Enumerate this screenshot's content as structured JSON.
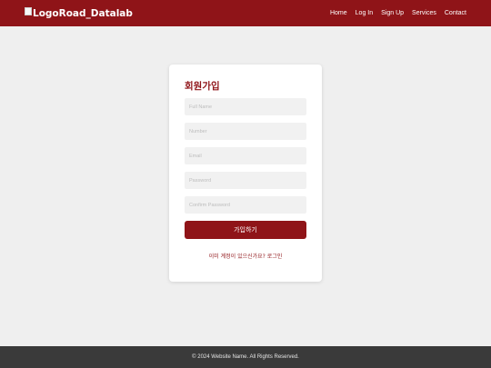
{
  "header": {
    "logo_text": "LogoRoad_Datalab",
    "nav": [
      {
        "label": "Home"
      },
      {
        "label": "Log In"
      },
      {
        "label": "Sign Up"
      },
      {
        "label": "Services"
      },
      {
        "label": "Contact"
      }
    ]
  },
  "signup": {
    "title": "회원가입",
    "fields": {
      "full_name": {
        "placeholder": "Full Name",
        "value": ""
      },
      "number": {
        "placeholder": "Number",
        "value": ""
      },
      "email": {
        "placeholder": "Email",
        "value": ""
      },
      "password": {
        "placeholder": "Password",
        "value": ""
      },
      "confirm_password": {
        "placeholder": "Confirm Password",
        "value": ""
      }
    },
    "submit_label": "가입하기",
    "login_link": "이미 계정이 있으신가요? 로그인"
  },
  "footer": {
    "text": "© 2024 Website Name. All Rights Reserved."
  },
  "colors": {
    "brand": "#8f1418",
    "page_background": "#efefef",
    "footer_background": "#3a3a3a"
  }
}
